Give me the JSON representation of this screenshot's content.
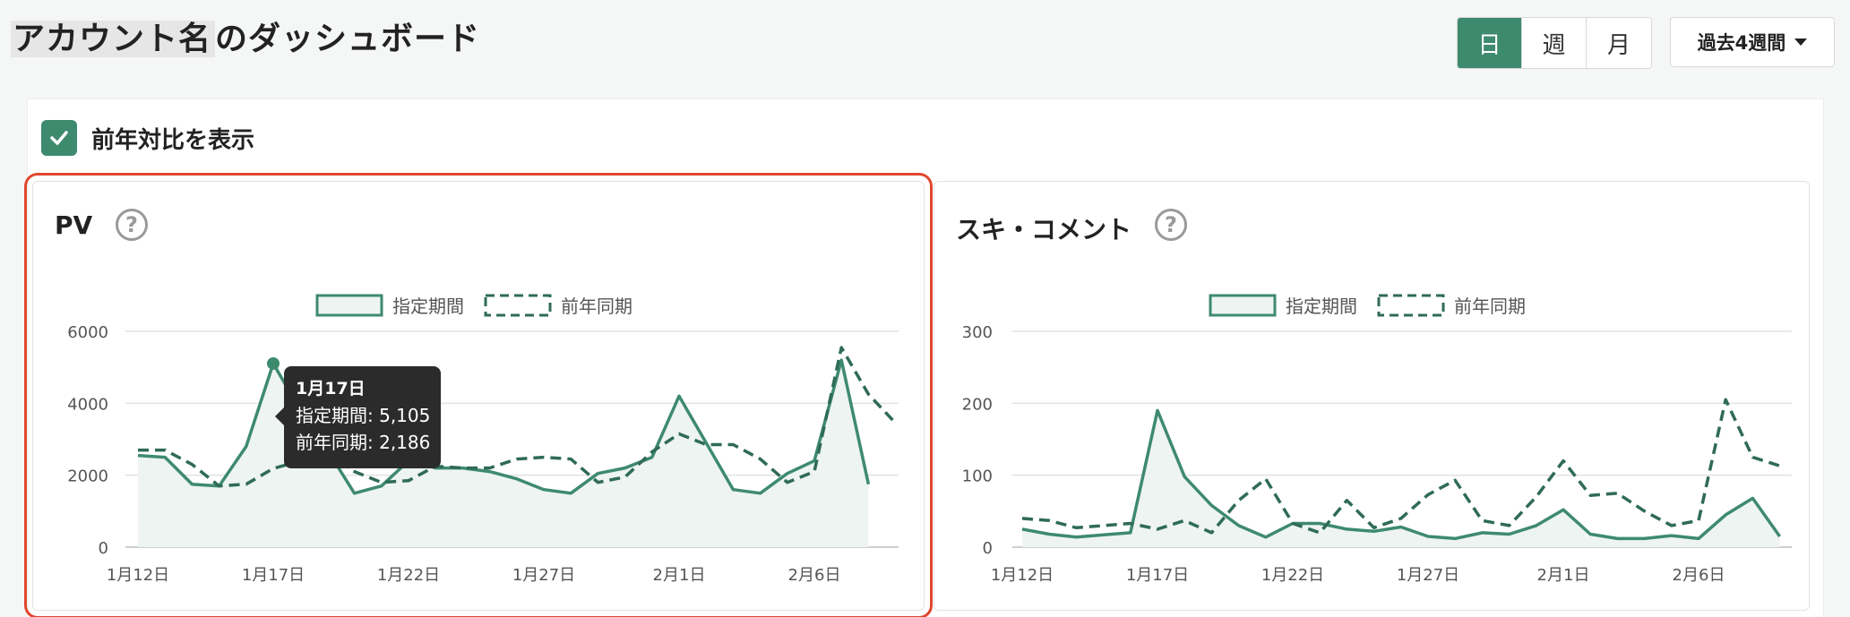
{
  "header": {
    "title_account": "アカウント名",
    "title_suffix": "のダッシュボード",
    "granularity": [
      {
        "label": "日",
        "active": true
      },
      {
        "label": "週",
        "active": false
      },
      {
        "label": "月",
        "active": false
      }
    ],
    "period_label": "過去4週間"
  },
  "yoy_toggle": {
    "label": "前年対比を表示",
    "checked": true
  },
  "colors": {
    "accent": "#3e8a6f",
    "highlight_border": "#e0472e",
    "fill": "#edf4f1"
  },
  "panels": {
    "pv": {
      "title": "PV",
      "help_icon": "?"
    },
    "likes": {
      "title": "スキ・コメント",
      "help_icon": "?"
    }
  },
  "tooltip": {
    "title": "1月17日",
    "line1": "指定期間: 5,105",
    "line2": "前年同期: 2,186"
  },
  "chart_data": [
    {
      "type": "line",
      "title": "PV",
      "legend": [
        "指定期間",
        "前年同期"
      ],
      "legend_position": "top-center",
      "x_tick_labels": [
        "1月12日",
        "1月17日",
        "1月22日",
        "1月27日",
        "2月1日",
        "2月6日"
      ],
      "x_tick_index": [
        0,
        5,
        10,
        15,
        20,
        25
      ],
      "y_ticks": [
        0,
        2000,
        4000,
        6000
      ],
      "ylim": [
        0,
        6000
      ],
      "grid": true,
      "highlight_index": 5,
      "series": [
        {
          "name": "指定期間",
          "style": "solid-area",
          "values": [
            2550,
            2500,
            1750,
            1700,
            2800,
            5105,
            3800,
            2700,
            1500,
            1700,
            2400,
            2200,
            2200,
            2100,
            1900,
            1600,
            1500,
            2050,
            2200,
            2500,
            4200,
            2900,
            1600,
            1500,
            2050,
            2400,
            5200,
            1750
          ]
        },
        {
          "name": "前年同期",
          "style": "dashed",
          "values": [
            2700,
            2700,
            2300,
            1700,
            1750,
            2186,
            2400,
            2600,
            2100,
            1800,
            1850,
            2250,
            2200,
            2200,
            2450,
            2500,
            2450,
            1800,
            1950,
            2650,
            3150,
            2850,
            2850,
            2450,
            1800,
            2100,
            5550,
            4250,
            3450
          ]
        }
      ]
    },
    {
      "type": "line",
      "title": "スキ・コメント",
      "legend": [
        "指定期間",
        "前年同期"
      ],
      "legend_position": "top-center",
      "x_tick_labels": [
        "1月12日",
        "1月17日",
        "1月22日",
        "1月27日",
        "2月1日",
        "2月6日"
      ],
      "x_tick_index": [
        0,
        5,
        10,
        15,
        20,
        25
      ],
      "y_ticks": [
        0,
        100,
        200,
        300
      ],
      "ylim": [
        0,
        300
      ],
      "grid": true,
      "series": [
        {
          "name": "指定期間",
          "style": "solid-area",
          "values": [
            25,
            18,
            14,
            17,
            20,
            190,
            98,
            58,
            30,
            14,
            33,
            33,
            25,
            22,
            28,
            15,
            12,
            20,
            18,
            30,
            52,
            18,
            12,
            12,
            16,
            12,
            45,
            68,
            15
          ]
        },
        {
          "name": "前年同期",
          "style": "dashed",
          "values": [
            40,
            37,
            27,
            30,
            33,
            25,
            37,
            20,
            65,
            95,
            33,
            20,
            65,
            27,
            40,
            73,
            93,
            37,
            30,
            70,
            120,
            72,
            75,
            50,
            30,
            37,
            205,
            125,
            113
          ]
        }
      ]
    }
  ]
}
